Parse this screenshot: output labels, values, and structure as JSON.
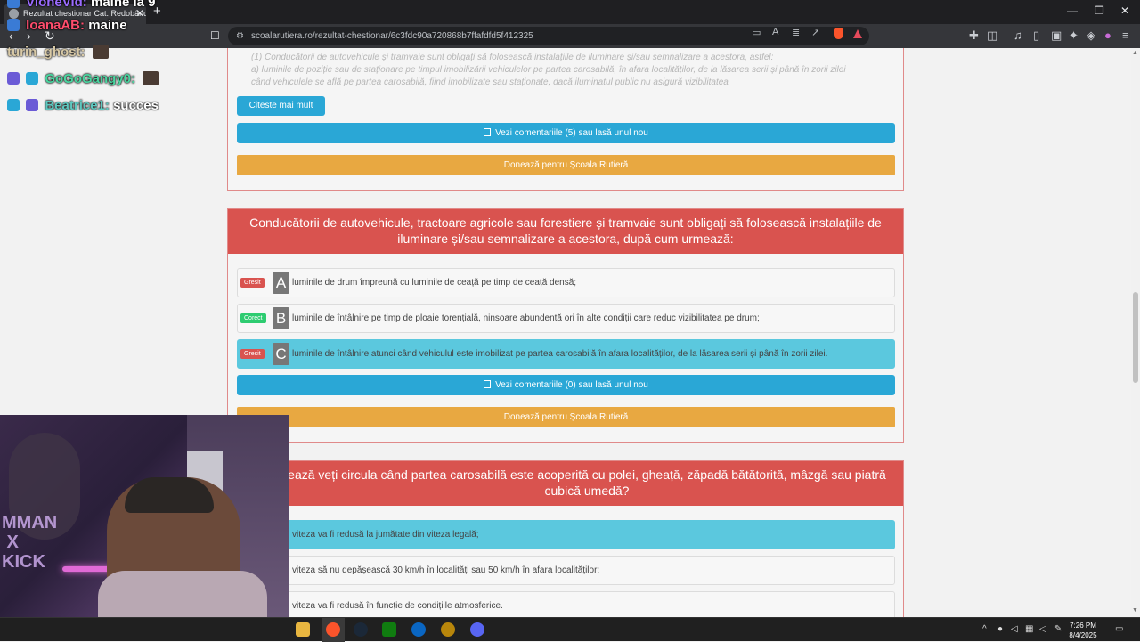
{
  "browser": {
    "tab_title": "Rezultat chestionar Cat. Redobândi...",
    "tab_close": "✕",
    "new_tab": "+",
    "url": "scoalarutiera.ro/rezultat-chestionar/6c3fdc90a720868b7ffafdfd5f412325"
  },
  "page": {
    "prev_card": {
      "faded_line_1": "(1) Conducătorii de autovehicule și tramvaie sunt obligați să folosească instalațiile de iluminare și/sau semnalizare a acestora, astfel:",
      "faded_line_2": "a) luminile de poziție sau de staționare pe timpul imobilizării vehiculelor pe partea carosabilă, în afara localităților, de la lăsarea serii și până în zorii zilei",
      "faded_line_3": "când vehiculele se află pe partea carosabilă, fiind imobilizate sau staționate, dacă iluminatul public nu asigură vizibilitatea",
      "read_more": "Citeste mai mult",
      "comments": "Vezi comentariile (5) sau lasă unul nou",
      "donate": "Donează pentru Școala Rutieră"
    },
    "question_card": {
      "question": "Conducătorii de autovehicule, tractoare agricole sau forestiere și tramvaie sunt obligați să folosească instalațiile de iluminare și/sau semnalizare a acestora, după cum urmează:",
      "answers": [
        {
          "status": "Gresit",
          "letter": "A",
          "text": "luminile de drum împreună cu luminile de ceață pe timp de ceață densă;"
        },
        {
          "status": "Corect",
          "letter": "B",
          "text": "luminile de întâlnire pe timp de ploaie torențială, ninsoare abundentă ori în alte condiții care reduc vizibilitatea pe drum;"
        },
        {
          "status": "Gresit",
          "letter": "C",
          "text": "luminile de întâlnire atunci când vehiculul este imobilizat pe partea carosabilă în afara localităților, de la lăsarea serii și până în zorii zilei."
        }
      ],
      "comments": "Vezi comentariile (0) sau lasă unul nou",
      "donate": "Donează pentru Școala Rutieră"
    },
    "next_card": {
      "question": "ează veți circula când partea carosabilă este acoperită cu polei, gheață, zăpadă bătătorită, mâzgă sau piatră cubică umedă?",
      "answers": [
        "viteza va fi redusă la jumătate din viteza legală;",
        "viteza să nu depășească 30 km/h în localități sau 50 km/h în afara localităților;",
        "viteza va fi redusă în funcție de condițiile atmosferice."
      ]
    }
  },
  "chat": [
    {
      "user": "VioneVid:",
      "message": "maine la 9",
      "color": "#9b6bff"
    },
    {
      "user": "IoanaAB:",
      "message": "maine",
      "color": "#ff4d6d"
    },
    {
      "user": "turin_ghost:",
      "message": "",
      "color": "#d8c9a6"
    },
    {
      "user": "GoGoGangy0:",
      "message": "",
      "color": "#49d6a0"
    },
    {
      "user": "Beatrice1:",
      "message": "succes",
      "color": "#5ec9c0"
    }
  ],
  "webcam": {
    "overlay_text": "MMAN\n X\nKICK"
  },
  "taskbar": {
    "time": "7:26 PM",
    "date": "8/4/2025"
  }
}
